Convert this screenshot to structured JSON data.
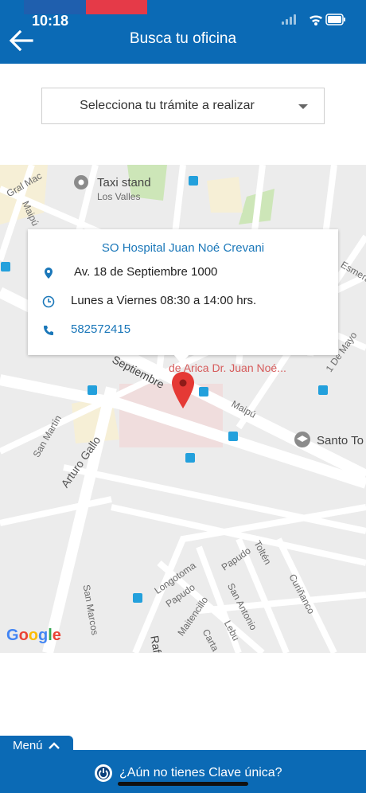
{
  "status_bar": {
    "time": "10:18"
  },
  "header": {
    "title": "Busca tu oficina"
  },
  "select": {
    "label": "Selecciona tu trámite a realizar"
  },
  "map": {
    "labels": [
      "Taxi stand",
      "Los Valles",
      "Gral Mac",
      "Maipú",
      "Esmerald",
      "1 De Mayo",
      "Septiembre",
      "de Arica Dr. Juan Noé...",
      "Maipú",
      "Santo To",
      "San Martín",
      "Arturo Gallo",
      "Longotoma",
      "Papudo",
      "Papudo",
      "Maitencillo",
      "San Antonio",
      "Toltén",
      "Curiñanco",
      "San Marcos",
      "Lebu",
      "Carta",
      "Rafa"
    ],
    "provider": "Google"
  },
  "info": {
    "title": "SO Hospital Juan Noé Crevani",
    "address": "Av. 18 de Septiembre  1000",
    "hours": "Lunes a Viernes 08:30 a 14:00 hrs.",
    "phone": "582572415"
  },
  "menu": {
    "label": "Menú"
  },
  "footer": {
    "clave": "¿Aún no tienes Clave única?"
  },
  "colors": {
    "brand": "#0b6ab5",
    "link": "#1a77b9",
    "pin": "#e53935"
  }
}
